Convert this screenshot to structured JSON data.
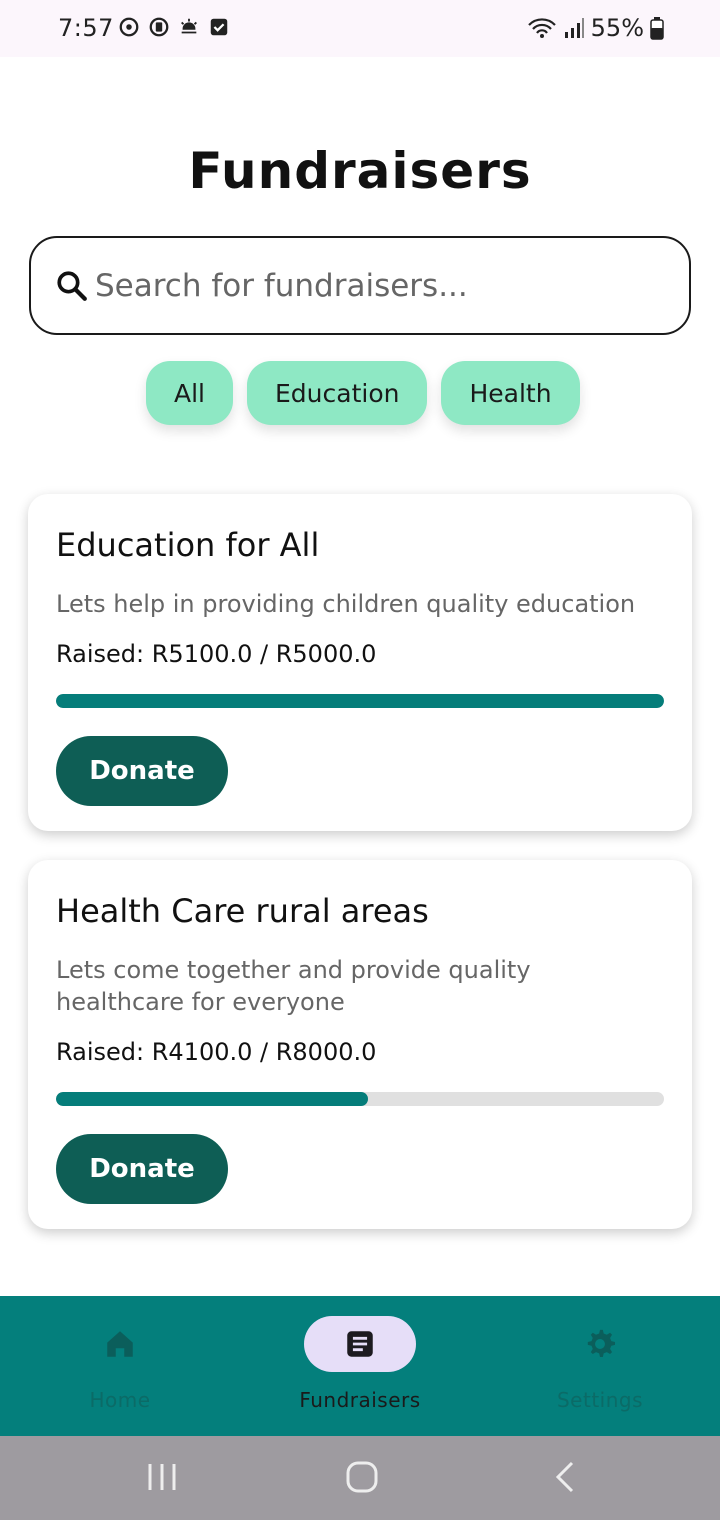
{
  "status_bar": {
    "time": "7:57",
    "battery": "55%"
  },
  "page": {
    "title": "Fundraisers"
  },
  "search": {
    "placeholder": "Search for fundraisers..."
  },
  "filters": [
    "All",
    "Education",
    "Health"
  ],
  "fundraisers": [
    {
      "title": "Education for All",
      "description": "Lets help in providing children quality education",
      "raised_text": "Raised: R5100.0 / R5000.0",
      "progress": 1.0,
      "button": "Donate"
    },
    {
      "title": "Health Care rural areas",
      "description": "Lets come together and provide quality healthcare for everyone",
      "raised_text": "Raised: R4100.0 / R8000.0",
      "progress": 0.5125,
      "button": "Donate"
    }
  ],
  "bottom_nav": {
    "items": [
      {
        "label": "Home",
        "icon": "home-icon"
      },
      {
        "label": "Fundraisers",
        "icon": "article-icon"
      },
      {
        "label": "Settings",
        "icon": "gear-icon"
      }
    ],
    "active_index": 1
  },
  "colors": {
    "accent": "#047f7c",
    "chip": "#8ee8c4",
    "button": "#0e5e55",
    "progress": "#057d7a"
  }
}
